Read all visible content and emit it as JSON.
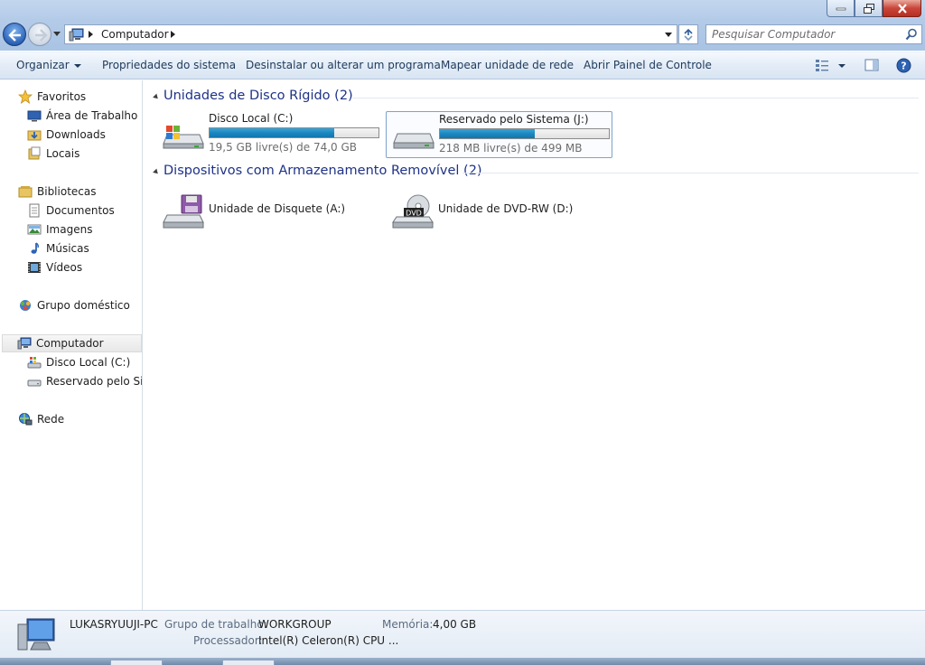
{
  "window": {
    "minimize_label": "minimize",
    "maximize_label": "restore",
    "close_label": "close"
  },
  "address": {
    "crumb": "Computador",
    "search_placeholder": "Pesquisar Computador"
  },
  "toolbar": {
    "organize": "Organizar",
    "system_properties": "Propriedades do sistema",
    "uninstall": "Desinstalar ou alterar um programa",
    "map_drive": "Mapear unidade de rede",
    "control_panel": "Abrir Painel de Controle"
  },
  "nav": {
    "favorites": "Favoritos",
    "desktop": "Área de Trabalho",
    "downloads": "Downloads",
    "places": "Locais",
    "libraries": "Bibliotecas",
    "documents": "Documentos",
    "images": "Imagens",
    "music": "Músicas",
    "videos": "Vídeos",
    "homegroup": "Grupo doméstico",
    "computer": "Computador",
    "local_disk": "Disco Local (C:)",
    "reserved": "Reservado pelo Sistema (J:)",
    "network": "Rede"
  },
  "groups": {
    "hard_drives": "Unidades de Disco Rígido (2)",
    "removable": "Dispositivos com Armazenamento Removível (2)"
  },
  "drives": [
    {
      "name": "Disco Local (C:)",
      "free": "19,5 GB livre(s) de 74,0 GB",
      "used_fraction": 0.74
    },
    {
      "name": "Reservado pelo Sistema (J:)",
      "free": "218 MB livre(s) de 499 MB",
      "used_fraction": 0.56
    }
  ],
  "removable": [
    {
      "name": "Unidade de Disquete (A:)"
    },
    {
      "name": "Unidade de DVD-RW (D:)",
      "badge": "DVD"
    }
  ],
  "details": {
    "pc_name": "LUKASRYUUJI-PC",
    "workgroup_label": "Grupo de trabalho:",
    "workgroup": "WORKGROUP",
    "memory_label": "Memória:",
    "memory": "4,00 GB",
    "processor_label": "Processador:",
    "processor": "Intel(R) Celeron(R) CPU ..."
  },
  "colors": {
    "group_title": "#1e3287",
    "bar_fill": "#1c87c0",
    "command_text": "#1e395b"
  }
}
